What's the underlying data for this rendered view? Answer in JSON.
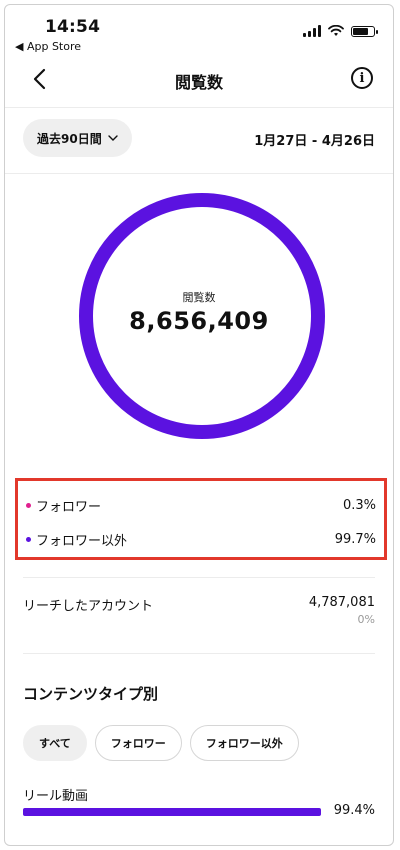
{
  "status_bar": {
    "time": "14:54",
    "back_app": "◀ App Store"
  },
  "header": {
    "title": "閲覧数",
    "info": "i"
  },
  "filter": {
    "period": "過去90日間",
    "date_range": "1月27日 - 4月26日"
  },
  "summary": {
    "label": "閲覧数",
    "value": "8,656,409"
  },
  "breakdown": [
    {
      "label": "フォロワー",
      "percent": "0.3%",
      "color": "#e0208f"
    },
    {
      "label": "フォロワー以外",
      "percent": "99.7%",
      "color": "#5b12e0"
    }
  ],
  "reach": {
    "label": "リーチしたアカウント",
    "value": "4,787,081",
    "sub": "0%"
  },
  "content_type": {
    "title": "コンテンツタイプ別",
    "chips": [
      "すべて",
      "フォロワー",
      "フォロワー以外"
    ],
    "reel": {
      "label": "リール動画",
      "percent_text": "99.4%",
      "fraction": 0.994
    }
  },
  "colors": {
    "accent": "#5b12e0",
    "follower": "#e0208f",
    "highlight_border": "#e2382b"
  }
}
